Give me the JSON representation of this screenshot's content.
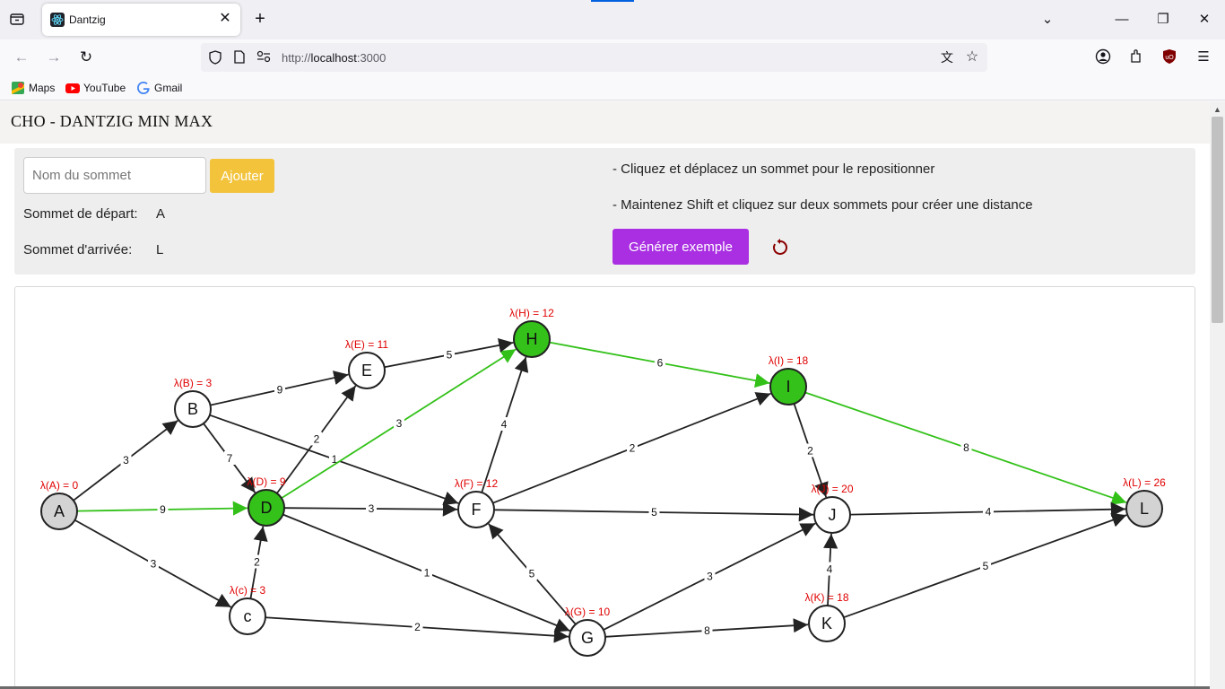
{
  "browser": {
    "tab_title": "Dantzig",
    "url_scheme": "http://",
    "url_host": "localhost",
    "url_rest": ":3000",
    "bookmarks": [
      {
        "label": "Maps",
        "icon": "maps-icon"
      },
      {
        "label": "YouTube",
        "icon": "youtube-icon"
      },
      {
        "label": "Gmail",
        "icon": "google-icon"
      }
    ]
  },
  "app": {
    "title": "CHO - DANTZIG MIN MAX",
    "input_placeholder": "Nom du sommet",
    "add_button": "Ajouter",
    "start_label": "Sommet de départ:",
    "start_value": "A",
    "end_label": "Sommet d'arrivée:",
    "end_value": "L",
    "hint1": "- Cliquez et déplacez un sommet pour le repositionner",
    "hint2": "- Maintenez Shift et cliquez sur deux sommets pour créer une distance",
    "generate_button": "Générer exemple"
  },
  "colors": {
    "path": "#33c119",
    "edge": "#222222",
    "lambda": "#e00000",
    "endpoint_fill": "#d3d3d3",
    "path_fill": "#34c21a"
  },
  "graph": {
    "nodes": [
      {
        "id": "A",
        "lambda": "λ(A) = 0",
        "state": "endpoint"
      },
      {
        "id": "B",
        "lambda": "λ(B) = 3",
        "state": "normal"
      },
      {
        "id": "E",
        "lambda": "λ(E) = 11",
        "state": "normal"
      },
      {
        "id": "H",
        "lambda": "λ(H) = 12",
        "state": "path"
      },
      {
        "id": "I",
        "lambda": "λ(I) = 18",
        "state": "path"
      },
      {
        "id": "D",
        "lambda": "λ(D) = 9",
        "state": "path"
      },
      {
        "id": "F",
        "lambda": "λ(F) = 12",
        "state": "normal"
      },
      {
        "id": "J",
        "lambda": "λ(J) = 20",
        "state": "normal"
      },
      {
        "id": "L",
        "lambda": "λ(L) = 26",
        "state": "endpoint"
      },
      {
        "id": "c",
        "lambda": "λ(c) = 3",
        "state": "normal"
      },
      {
        "id": "G",
        "lambda": "λ(G) = 10",
        "state": "normal"
      },
      {
        "id": "K",
        "lambda": "λ(K) = 18",
        "state": "normal"
      }
    ],
    "edges": [
      {
        "from": "A",
        "to": "B",
        "w": "3",
        "path": false
      },
      {
        "from": "A",
        "to": "D",
        "w": "9",
        "path": true
      },
      {
        "from": "A",
        "to": "c",
        "w": "3",
        "path": false
      },
      {
        "from": "B",
        "to": "E",
        "w": "9",
        "path": false
      },
      {
        "from": "B",
        "to": "D",
        "w": "7",
        "path": false
      },
      {
        "from": "B",
        "to": "F",
        "w": "1",
        "path": false
      },
      {
        "from": "c",
        "to": "D",
        "w": "2",
        "path": false
      },
      {
        "from": "c",
        "to": "G",
        "w": "2",
        "path": false
      },
      {
        "from": "D",
        "to": "E",
        "w": "2",
        "path": false
      },
      {
        "from": "D",
        "to": "H",
        "w": "3",
        "path": true
      },
      {
        "from": "D",
        "to": "F",
        "w": "3",
        "path": false
      },
      {
        "from": "D",
        "to": "G",
        "w": "1",
        "path": false
      },
      {
        "from": "E",
        "to": "H",
        "w": "5",
        "path": false
      },
      {
        "from": "F",
        "to": "H",
        "w": "4",
        "path": false
      },
      {
        "from": "F",
        "to": "I",
        "w": "2",
        "path": false
      },
      {
        "from": "F",
        "to": "J",
        "w": "5",
        "path": false
      },
      {
        "from": "G",
        "to": "F",
        "w": "5",
        "path": false
      },
      {
        "from": "G",
        "to": "J",
        "w": "3",
        "path": false
      },
      {
        "from": "G",
        "to": "K",
        "w": "8",
        "path": false
      },
      {
        "from": "H",
        "to": "I",
        "w": "6",
        "path": true
      },
      {
        "from": "I",
        "to": "J",
        "w": "2",
        "path": false
      },
      {
        "from": "I",
        "to": "L",
        "w": "8",
        "path": true
      },
      {
        "from": "J",
        "to": "L",
        "w": "4",
        "path": false
      },
      {
        "from": "K",
        "to": "J",
        "w": "4",
        "path": false
      },
      {
        "from": "K",
        "to": "L",
        "w": "5",
        "path": false
      }
    ]
  }
}
